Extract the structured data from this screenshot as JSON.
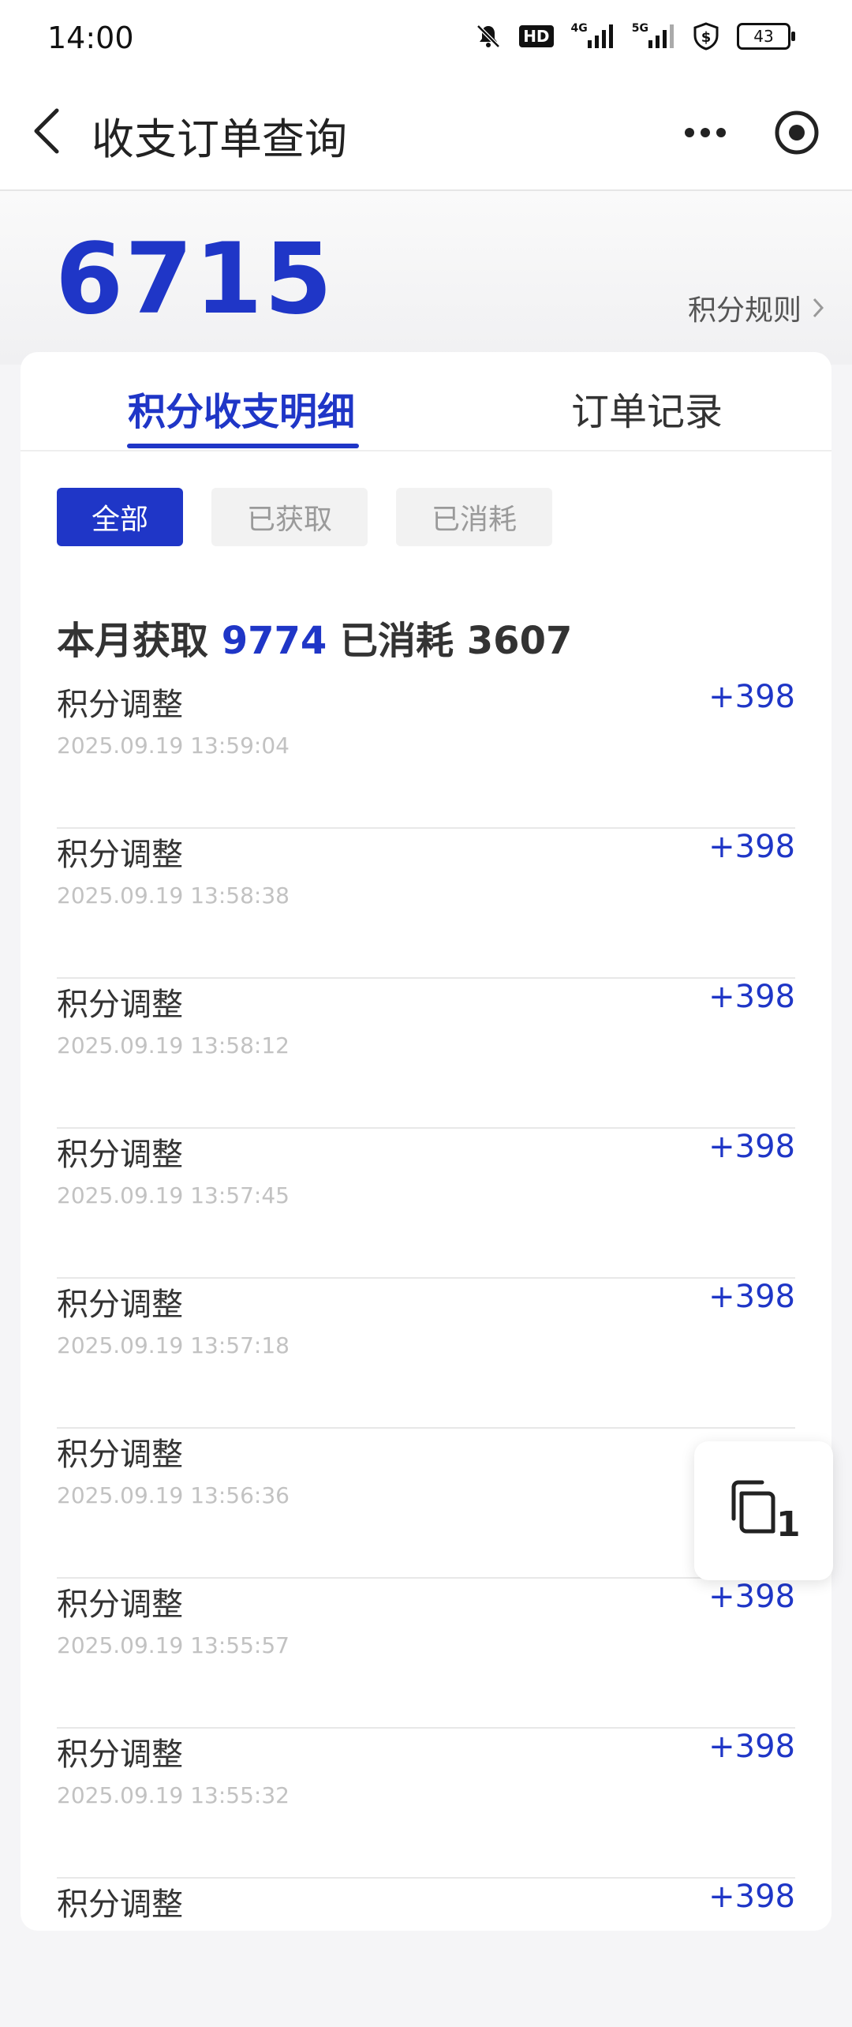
{
  "status": {
    "time": "14:00",
    "battery": "43",
    "hd_label": "HD",
    "net1": "4G",
    "net2": "5G"
  },
  "navbar": {
    "title": "收支订单查询"
  },
  "hero": {
    "points": "6715",
    "rules_label": "积分规则"
  },
  "tabs": [
    {
      "label": "积分收支明细",
      "active": true
    },
    {
      "label": "订单记录",
      "active": false
    }
  ],
  "filters": [
    {
      "label": "全部",
      "active": true
    },
    {
      "label": "已获取",
      "active": false
    },
    {
      "label": "已消耗",
      "active": false
    }
  ],
  "summary": {
    "earned_label": "本月获取",
    "earned_value": "9774",
    "spent_label": "已消耗",
    "spent_value": "3607"
  },
  "records": [
    {
      "title": "积分调整",
      "time": "2025.09.19 13:59:04",
      "amount": "+398"
    },
    {
      "title": "积分调整",
      "time": "2025.09.19 13:58:38",
      "amount": "+398"
    },
    {
      "title": "积分调整",
      "time": "2025.09.19 13:58:12",
      "amount": "+398"
    },
    {
      "title": "积分调整",
      "time": "2025.09.19 13:57:45",
      "amount": "+398"
    },
    {
      "title": "积分调整",
      "time": "2025.09.19 13:57:18",
      "amount": "+398"
    },
    {
      "title": "积分调整",
      "time": "2025.09.19 13:56:36",
      "amount": ""
    },
    {
      "title": "积分调整",
      "time": "2025.09.19 13:55:57",
      "amount": "+398"
    },
    {
      "title": "积分调整",
      "time": "2025.09.19 13:55:32",
      "amount": "+398"
    },
    {
      "title": "积分调整",
      "time": "",
      "amount": "+398"
    }
  ],
  "float_button": {
    "count": "1"
  },
  "colors": {
    "accent": "#1f36c7",
    "muted": "#c2c2c2"
  }
}
